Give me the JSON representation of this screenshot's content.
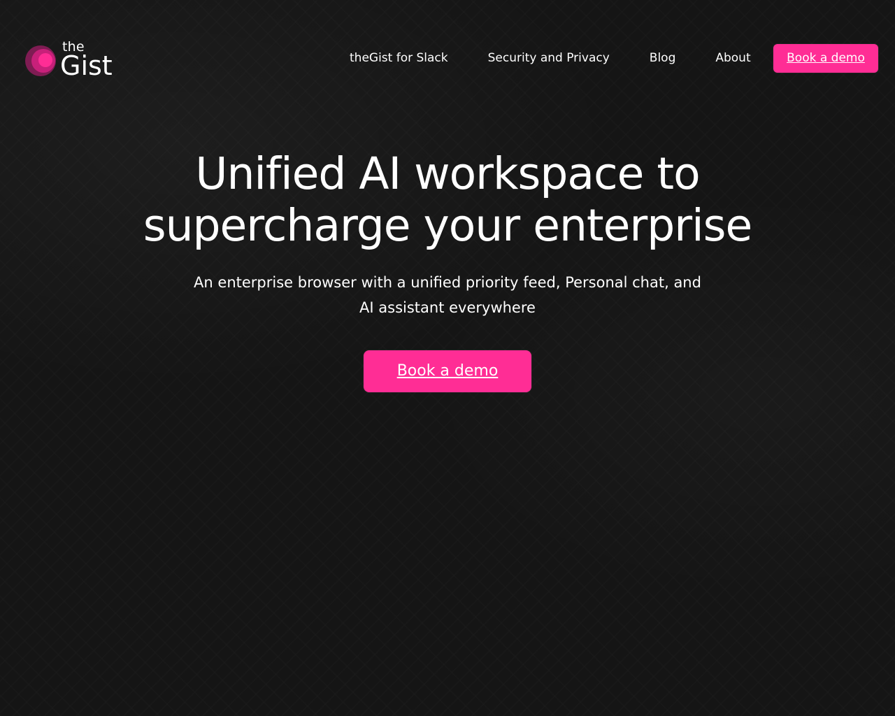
{
  "brand": {
    "small": "the",
    "big": "Gist",
    "icon": "logo-icon",
    "accent": "#ff2d95"
  },
  "nav": {
    "items": [
      {
        "label": "theGist for Slack"
      },
      {
        "label": "Security and Privacy"
      },
      {
        "label": "Blog"
      },
      {
        "label": "About"
      }
    ],
    "cta_label": "Book a demo"
  },
  "hero": {
    "title_line1": "Unified AI workspace to",
    "title_line2": "supercharge your enterprise",
    "subtitle_line1": "An enterprise browser with a unified priority feed, Personal chat, and",
    "subtitle_line2": "AI assistant everywhere",
    "cta_label": "Book a demo"
  },
  "colors": {
    "background": "#151515",
    "accent": "#ff2d95",
    "text": "#ffffff"
  }
}
